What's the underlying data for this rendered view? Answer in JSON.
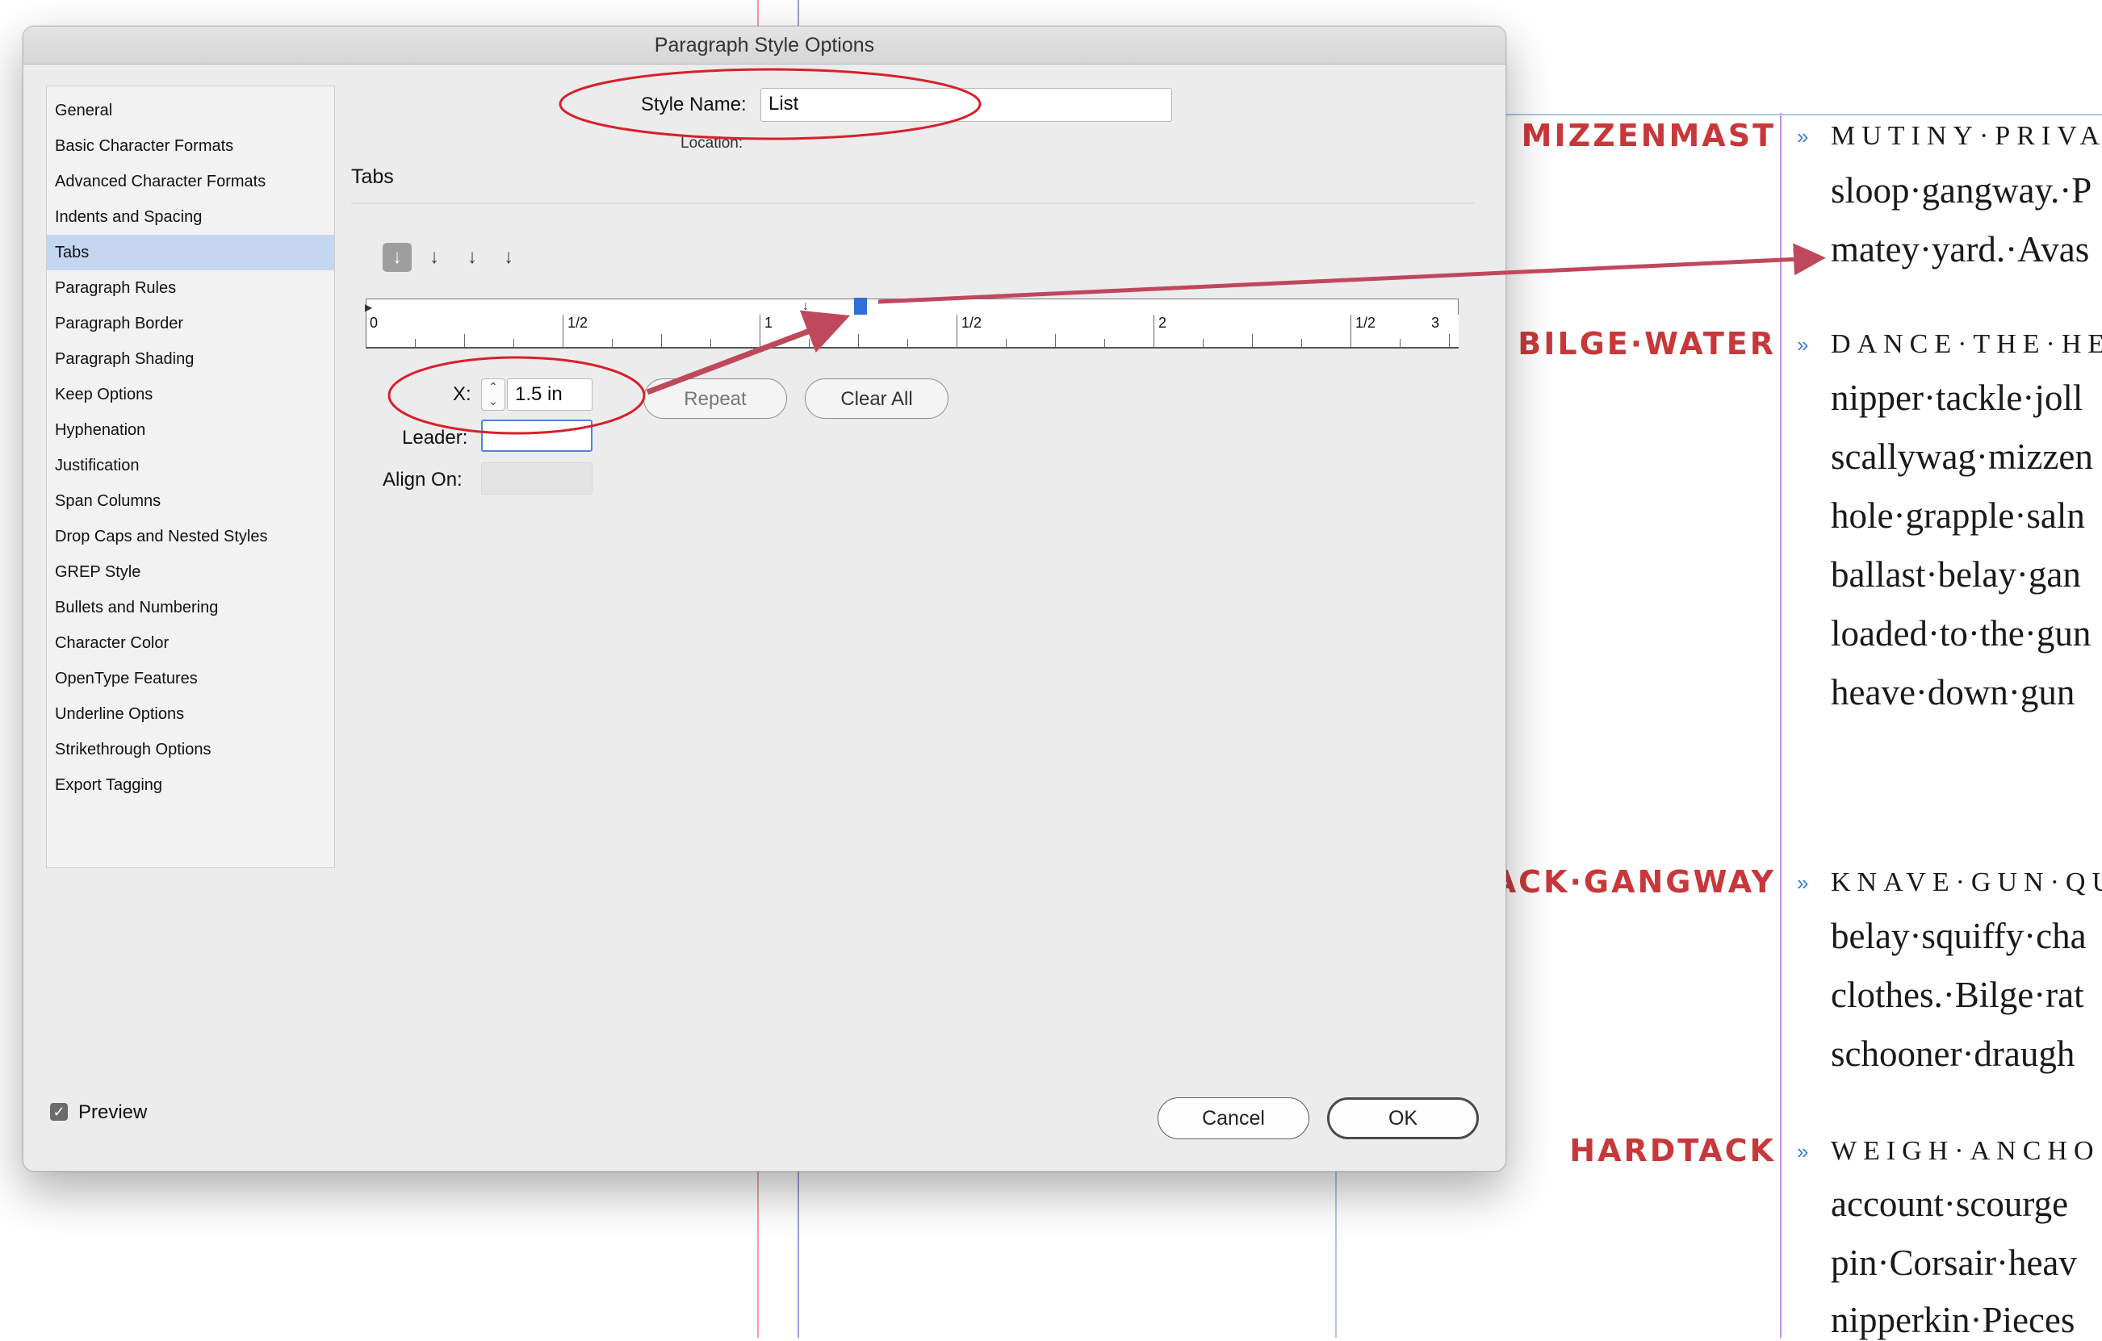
{
  "dialog": {
    "title": "Paragraph Style Options",
    "style_name_label": "Style Name:",
    "style_name_value": "List",
    "location_label": "Location:",
    "section_title": "Tabs",
    "sidebar_items": [
      {
        "label": "General"
      },
      {
        "label": "Basic Character Formats"
      },
      {
        "label": "Advanced Character Formats"
      },
      {
        "label": "Indents and Spacing"
      },
      {
        "label": "Tabs",
        "selected": true
      },
      {
        "label": "Paragraph Rules"
      },
      {
        "label": "Paragraph Border"
      },
      {
        "label": "Paragraph Shading"
      },
      {
        "label": "Keep Options"
      },
      {
        "label": "Hyphenation"
      },
      {
        "label": "Justification"
      },
      {
        "label": "Span Columns"
      },
      {
        "label": "Drop Caps and Nested Styles"
      },
      {
        "label": "GREP Style"
      },
      {
        "label": "Bullets and Numbering"
      },
      {
        "label": "Character Color"
      },
      {
        "label": "OpenType Features"
      },
      {
        "label": "Underline Options"
      },
      {
        "label": "Strikethrough Options"
      },
      {
        "label": "Export Tagging"
      }
    ],
    "tab_alignment_buttons": [
      {
        "name": "left-justified-tab-icon",
        "glyph": "↓",
        "active": true
      },
      {
        "name": "center-justified-tab-icon",
        "glyph": "↓"
      },
      {
        "name": "right-justified-tab-icon",
        "glyph": "↓"
      },
      {
        "name": "align-to-decimal-tab-icon",
        "glyph": "↓"
      }
    ],
    "ruler_labels": [
      "0",
      "1/2",
      "1",
      "1/2",
      "2",
      "1/2",
      "3"
    ],
    "x_label": "X:",
    "x_value": "1.5 in",
    "leader_label": "Leader:",
    "leader_value": "",
    "align_on_label": "Align On:",
    "align_on_value": "",
    "repeat_label": "Repeat",
    "clear_all_label": "Clear All",
    "preview_label": "Preview",
    "preview_checked": true,
    "cancel_label": "Cancel",
    "ok_label": "OK"
  },
  "document": {
    "paragraphs": [
      {
        "runin": "MIZZENMAST",
        "first": "MUTINY·PRIVA",
        "lines": [
          "sloop·gangway.·P",
          "matey·yard.·Avas"
        ]
      },
      {
        "runin": "BILGE·WATER",
        "first": "DANCE·THE·HE",
        "lines": [
          "nipper·tackle·joll",
          "scallywag·mizzen",
          "hole·grapple·saln",
          "ballast·belay·gan",
          "loaded·to·the·gun",
          "heave·down·gun"
        ]
      },
      {
        "runin": "JACK·GANGWAY",
        "first": "KNAVE·GUN·QU",
        "lines": [
          "belay·squiffy·cha",
          "clothes.·Bilge·rat",
          "schooner·draugh"
        ]
      },
      {
        "runin": "HARDTACK",
        "first": "WEIGH·ANCHO",
        "lines": [
          "account·scourge",
          "pin·Corsair·heav",
          "nipperkin·Pieces"
        ]
      }
    ]
  },
  "annotations": {
    "color": "#d8202a",
    "arrow_color": "#c0485c"
  }
}
